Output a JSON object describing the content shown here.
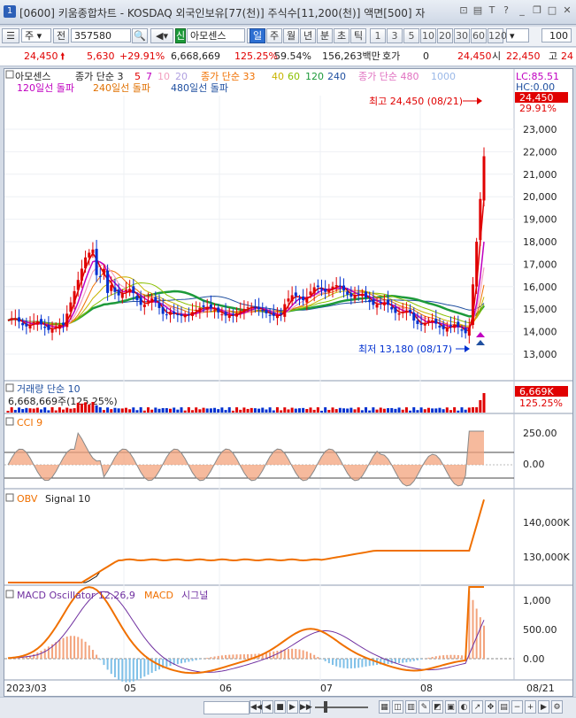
{
  "window": {
    "number": "1",
    "title": "[0600] 키움종합차트 - KOSDAQ 외국인보유[77(천)] 주식수[11,200(천)] 액면[500] 자"
  },
  "toolbar": {
    "period_select": "주",
    "prev_label": "전",
    "code": "357580",
    "stock_label": "아모센스",
    "periods": [
      "일",
      "주",
      "월",
      "년",
      "분",
      "초",
      "틱"
    ],
    "active_period": "일",
    "numbers": [
      "1",
      "3",
      "5",
      "10",
      "20",
      "30",
      "60",
      "120"
    ],
    "count": "100"
  },
  "quote": {
    "price": "24,450",
    "change": "5,630",
    "change_pct": "+29.91%",
    "volume": "6,668,669",
    "vol_ratio": "125.25%",
    "rate": "59.54%",
    "amount": "156,263백만",
    "hoga_label": "호가",
    "hoga_val": "0",
    "ask": "24,450",
    "open_label": "시",
    "open": "22,450",
    "high_label": "고",
    "high_partial": "24"
  },
  "main_panel": {
    "legend": {
      "stock": "아모센스",
      "ma_label": "종가 단순 3",
      "ma_periods": [
        "5",
        "7",
        "10",
        "20"
      ],
      "ma2_label": "종가 단순 33",
      "ma2_periods": [
        "40",
        "60",
        "120",
        "240"
      ],
      "ma3_label": "종가 단순 480",
      "ma3_period": "1000",
      "breakout1": "120일선 돌파",
      "breakout2": "240일선 돌파",
      "breakout3": "480일선 돌파"
    },
    "lc": "LC:85.51",
    "hc": "HC:0.00",
    "price_tag": "24,450",
    "pct_tag": "29.91%",
    "high_note": "최고 24,450 (08/21)",
    "low_note": "최저 13,180 (08/17)",
    "y_ticks": [
      "23,000",
      "22,000",
      "21,000",
      "20,000",
      "19,000",
      "18,000",
      "17,000",
      "16,000",
      "15,000",
      "14,000",
      "13,000"
    ]
  },
  "volume_panel": {
    "title": "거래량 단순 10",
    "value_text": "6,668,669주(125.25%)",
    "tag": "6,669K",
    "pct": "125.25%"
  },
  "cci_panel": {
    "title": "CCI 9",
    "ticks": [
      "250.00",
      "0.00"
    ]
  },
  "obv_panel": {
    "title": "OBV",
    "signal": "Signal 10",
    "ticks": [
      "140,000K",
      "130,000K"
    ]
  },
  "macd_panel": {
    "title": "MACD Oscillator 12,26,9",
    "macd": "MACD",
    "signal": "시그널",
    "ticks": [
      "1,000",
      "500.00",
      "0.00"
    ]
  },
  "x_axis": {
    "labels": [
      "2023/03",
      "05",
      "06",
      "07",
      "08"
    ],
    "end_label": "08/21"
  },
  "colors": {
    "up": "#e00000",
    "down": "#0030d0",
    "ma_green": "#1d9a3a",
    "cci_fill": "#f3a37c",
    "obv_orange": "#f07000",
    "macd_purple": "#7030a0"
  }
}
